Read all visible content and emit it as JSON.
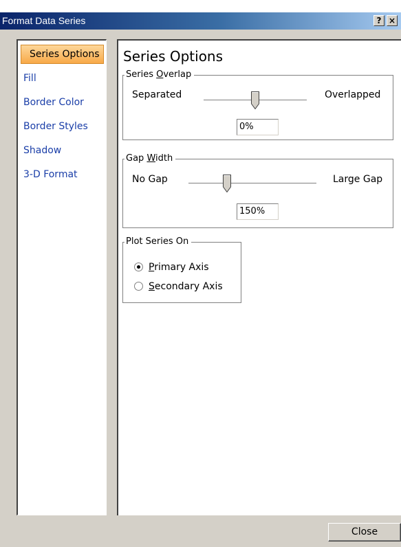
{
  "window": {
    "title": "Format Data Series",
    "help_button": "?",
    "close_button": "×"
  },
  "nav": {
    "items": [
      {
        "label": "Series Options",
        "selected": true
      },
      {
        "label": "Fill",
        "selected": false
      },
      {
        "label": "Border Color",
        "selected": false
      },
      {
        "label": "Border Styles",
        "selected": false
      },
      {
        "label": "Shadow",
        "selected": false
      },
      {
        "label": "3-D Format",
        "selected": false
      }
    ]
  },
  "panel": {
    "title": "Series Options",
    "series_overlap": {
      "group_label_pre": "Series ",
      "group_label_key": "O",
      "group_label_post": "verlap",
      "min_label": "Separated",
      "max_label": "Overlapped",
      "value": "0%",
      "slider_fraction": 0.5
    },
    "gap_width": {
      "group_label_pre": "Gap ",
      "group_label_key": "W",
      "group_label_post": "idth",
      "min_label": "No Gap",
      "max_label": "Large Gap",
      "value": "150%",
      "slider_fraction": 0.3
    },
    "plot_series_on": {
      "group_label": "Plot Series On",
      "options": [
        {
          "key": "P",
          "rest": "rimary Axis",
          "checked": true
        },
        {
          "key": "S",
          "rest": "econdary Axis",
          "checked": false
        }
      ]
    }
  },
  "footer": {
    "close_label": "Close"
  },
  "colors": {
    "titlebar_start": "#0a246a",
    "dialog_bg": "#d4d0c8",
    "nav_link": "#1a3ea8",
    "nav_selected_bg": "#f8a948"
  }
}
